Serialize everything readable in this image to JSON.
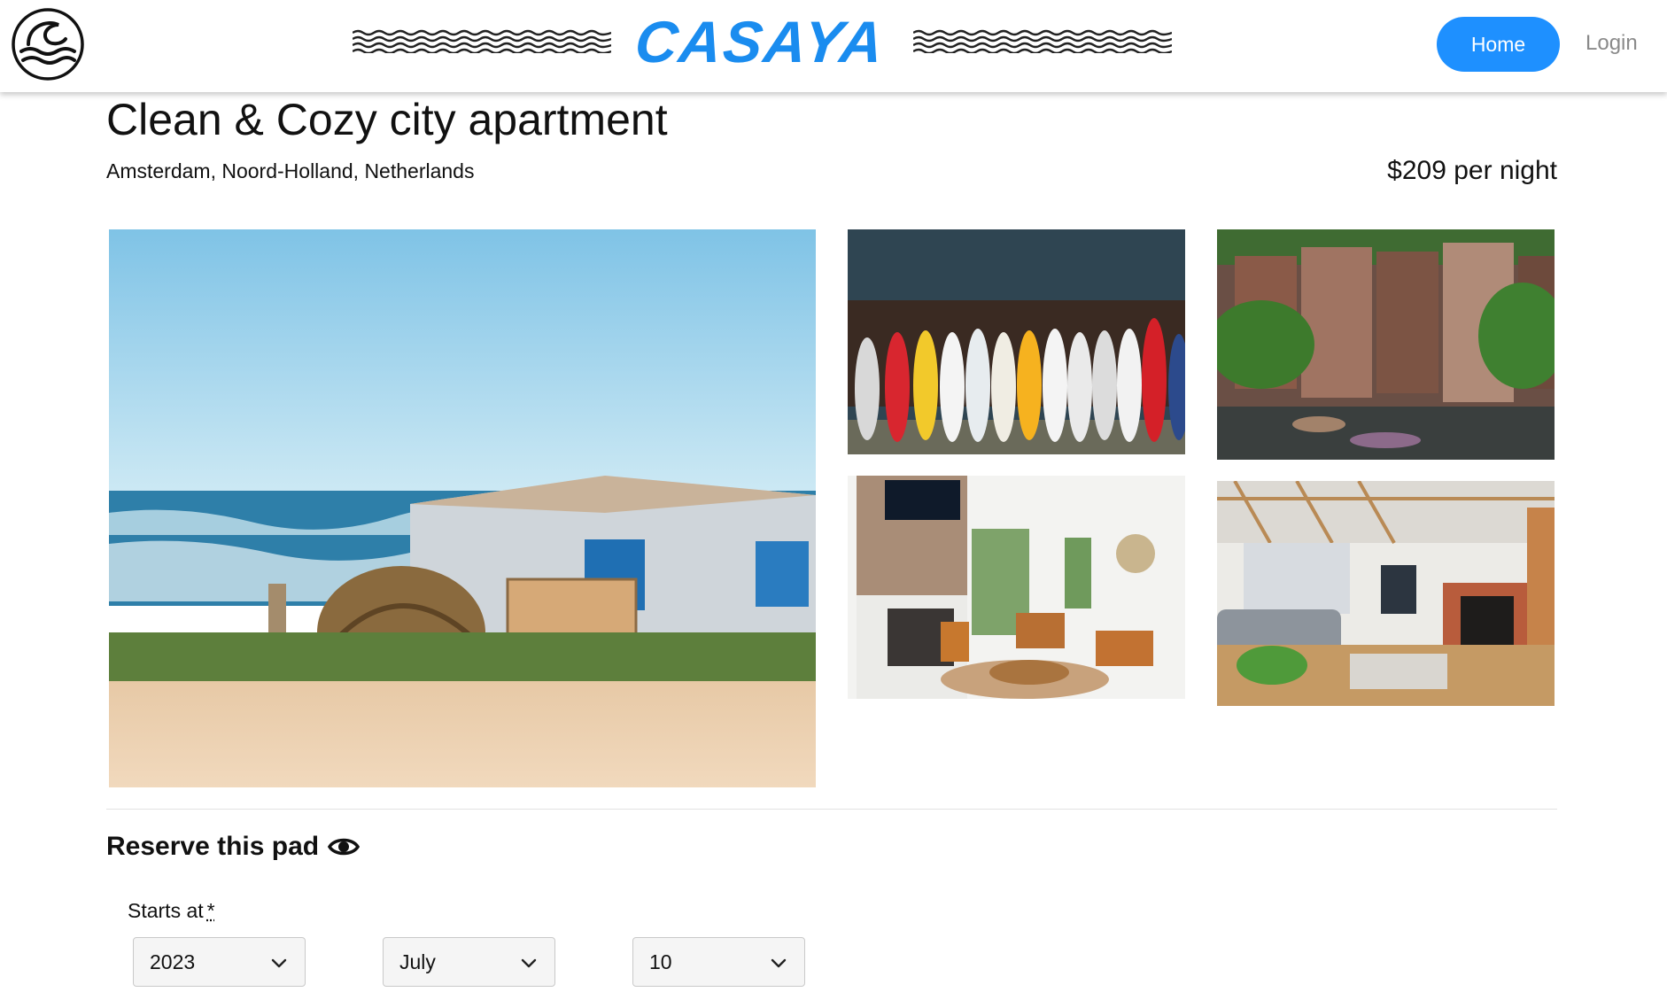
{
  "header": {
    "brand": "CASAYA",
    "nav": {
      "home_label": "Home",
      "login_label": "Login"
    },
    "logo_icon": "wave-logo-icon"
  },
  "listing": {
    "title": "Clean & Cozy city apartment",
    "location": "Amsterdam, Noord-Holland, Netherlands",
    "price": "$209 per night"
  },
  "gallery": {
    "photos": [
      {
        "subject": "beach hut with thatched umbrella"
      },
      {
        "subject": "row of surfboards"
      },
      {
        "subject": "Amsterdam canal houses"
      },
      {
        "subject": "living room with fireplace and leather chairs"
      },
      {
        "subject": "open living room with grey sofa"
      }
    ]
  },
  "reserve": {
    "heading": "Reserve this pad",
    "heading_icon": "eye-icon",
    "starts_label": "Starts at",
    "required_mark": "*",
    "year": "2023",
    "month": "July",
    "day": "10"
  },
  "colors": {
    "brand_blue": "#1a8cef",
    "button_blue": "#1e90ff",
    "login_grey": "#8a8a8a"
  }
}
